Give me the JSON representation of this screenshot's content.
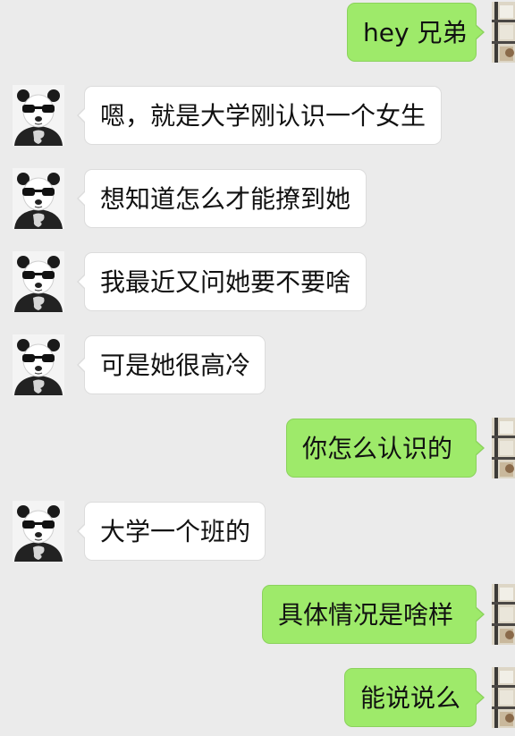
{
  "chat": {
    "messages": [
      {
        "sender": "me",
        "text": "hey 兄弟"
      },
      {
        "sender": "friend",
        "text": "嗯，就是大学刚认识一个女生"
      },
      {
        "sender": "friend",
        "text": "想知道怎么才能撩到她"
      },
      {
        "sender": "friend",
        "text": "我最近又问她要不要啥"
      },
      {
        "sender": "friend",
        "text": "可是她很高冷"
      },
      {
        "sender": "me",
        "text": "你怎么认识的"
      },
      {
        "sender": "friend",
        "text": "大学一个班的"
      },
      {
        "sender": "me",
        "text": "具体情况是啥样"
      },
      {
        "sender": "me",
        "text": "能说说么"
      }
    ]
  },
  "colors": {
    "background": "#ebebeb",
    "incoming_bubble": "#ffffff",
    "outgoing_bubble": "#9eea6a"
  },
  "icons": {
    "friend_avatar": "panda-avatar-icon",
    "my_avatar": "window-photo-avatar-icon"
  }
}
